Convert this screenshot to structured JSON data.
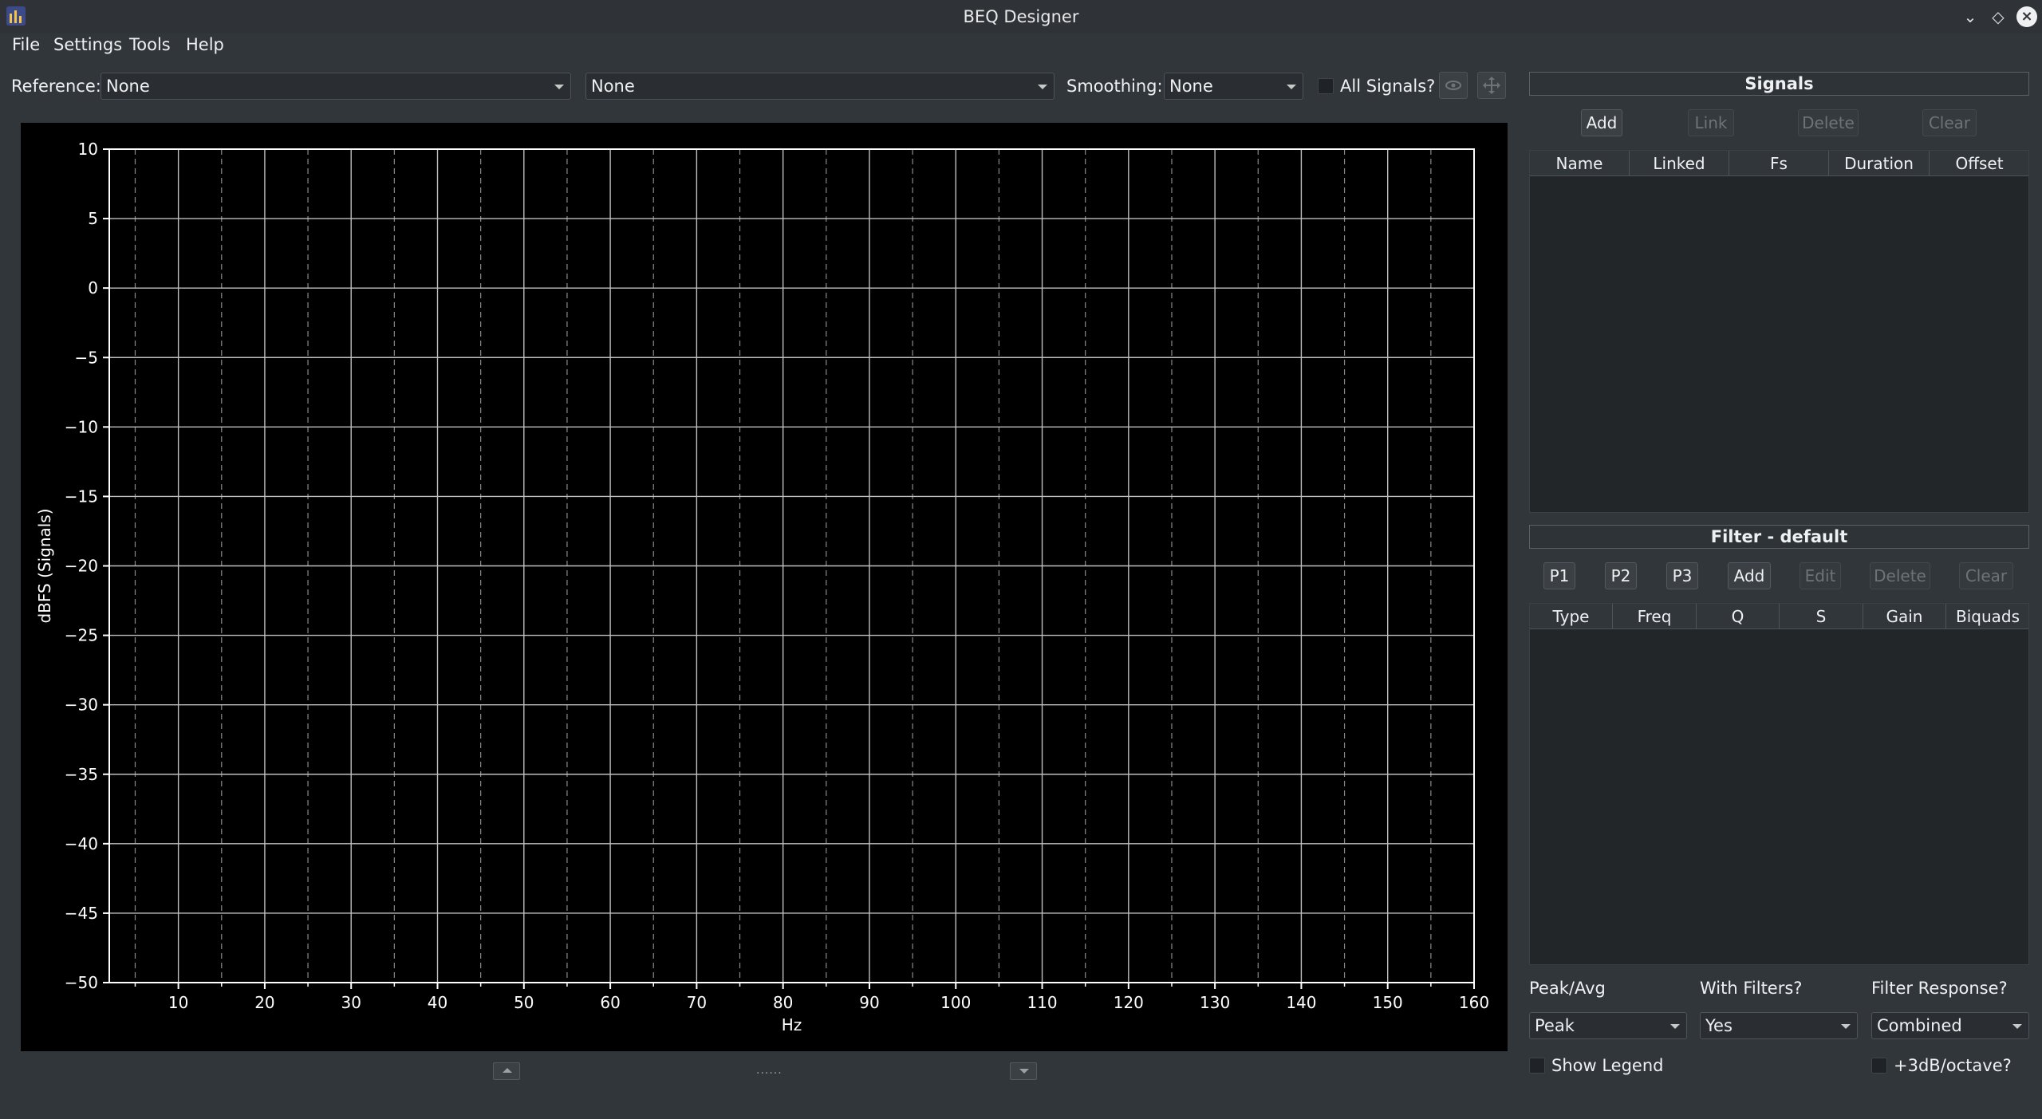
{
  "window": {
    "title": "BEQ Designer"
  },
  "menu": [
    "File",
    "Settings",
    "Tools",
    "Help"
  ],
  "toolbar": {
    "reference_label": "Reference:",
    "reference_value": "None",
    "reference2_value": "None",
    "smoothing_label": "Smoothing:",
    "smoothing_value": "None",
    "all_signals_label": "All Signals?"
  },
  "signals": {
    "title": "Signals",
    "buttons": [
      "Add",
      "Link",
      "Delete",
      "Clear"
    ],
    "columns": [
      "Name",
      "Linked",
      "Fs",
      "Duration",
      "Offset"
    ]
  },
  "filter": {
    "title": "Filter - default",
    "buttons": [
      "P1",
      "P2",
      "P3",
      "Add",
      "Edit",
      "Delete",
      "Clear"
    ],
    "columns": [
      "Type",
      "Freq",
      "Q",
      "S",
      "Gain",
      "Biquads"
    ]
  },
  "bottom": {
    "peak_avg_label": "Peak/Avg",
    "peak_avg_value": "Peak",
    "with_filters_label": "With Filters?",
    "with_filters_value": "Yes",
    "filter_response_label": "Filter Response?",
    "filter_response_value": "Combined",
    "show_legend_label": "Show Legend",
    "octave_label": "+3dB/octave?"
  },
  "colors": {
    "plot_bg": "#000000",
    "grid_major": "#bfbfbf",
    "grid_minor": "#8a8a8a",
    "panel_bg": "#31363b"
  },
  "chart_data": {
    "type": "line",
    "xlabel": "Hz",
    "ylabel": "dBFS (Signals)",
    "xlim": [
      2,
      160
    ],
    "ylim": [
      -50,
      10
    ],
    "x_ticks": [
      10,
      20,
      30,
      40,
      50,
      60,
      70,
      80,
      90,
      100,
      110,
      120,
      130,
      140,
      150,
      160
    ],
    "x_minor_ticks": [
      5,
      15,
      25,
      35,
      45,
      55,
      65,
      75,
      85,
      95,
      105,
      115,
      125,
      135,
      145,
      155
    ],
    "y_ticks": [
      10,
      5,
      0,
      -5,
      -10,
      -15,
      -20,
      -25,
      -30,
      -35,
      -40,
      -45,
      -50
    ],
    "grid": true,
    "series": []
  }
}
